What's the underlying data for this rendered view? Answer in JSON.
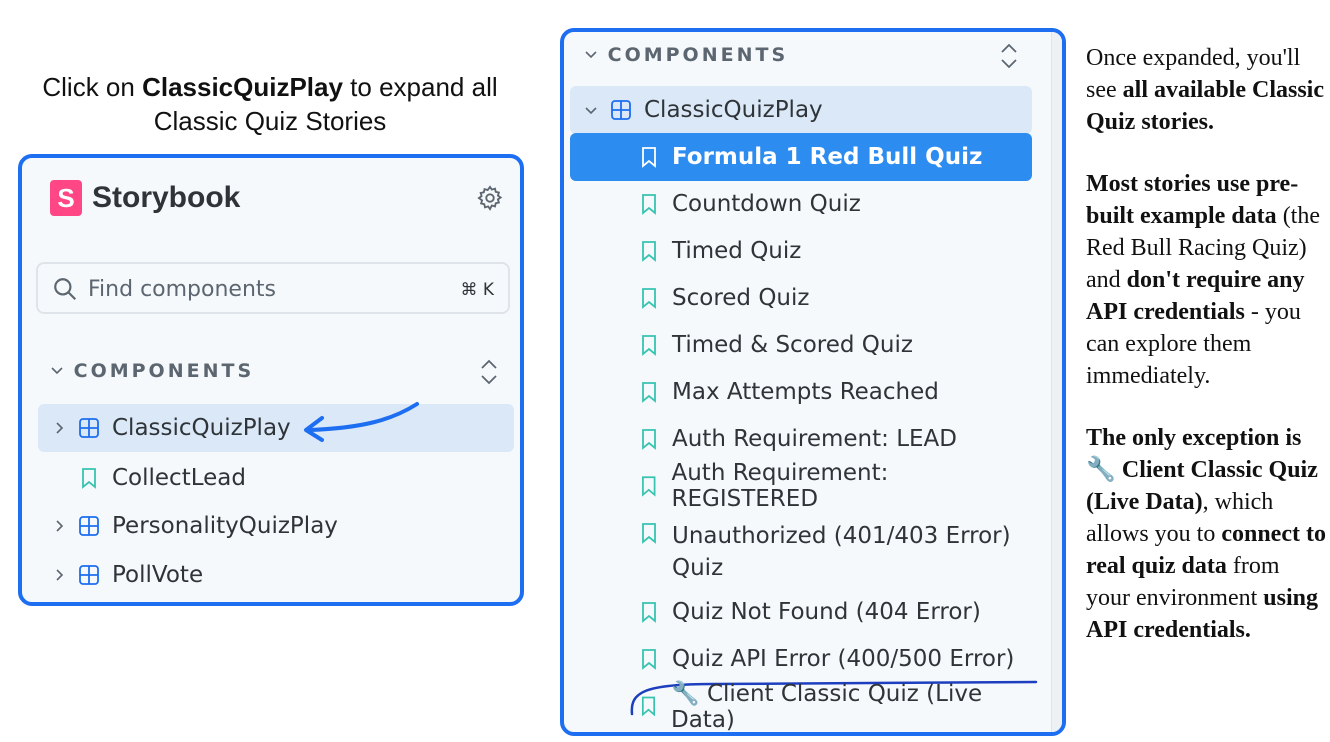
{
  "caption": {
    "before": "Click on ",
    "bold": "ClassicQuizPlay",
    "after": " to expand all Classic Quiz Stories"
  },
  "left_panel": {
    "brand": "Storybook",
    "logo_letter": "S",
    "search_placeholder": "Find components",
    "search_shortcut": "⌘ K",
    "section_label": "COMPONENTS",
    "items": [
      {
        "label": "ClassicQuizPlay",
        "kind": "component",
        "expanded": false,
        "highlighted": true
      },
      {
        "label": "CollectLead",
        "kind": "story"
      },
      {
        "label": "PersonalityQuizPlay",
        "kind": "component",
        "expanded": false
      },
      {
        "label": "PollVote",
        "kind": "component",
        "expanded": false
      }
    ]
  },
  "right_panel": {
    "section_label": "COMPONENTS",
    "group_label": "ClassicQuizPlay",
    "stories": [
      {
        "label": "Formula 1 Red Bull Quiz",
        "selected": true
      },
      {
        "label": "Countdown Quiz"
      },
      {
        "label": "Timed Quiz"
      },
      {
        "label": "Scored Quiz"
      },
      {
        "label": "Timed & Scored Quiz"
      },
      {
        "label": "Max Attempts Reached"
      },
      {
        "label": "Auth Requirement: LEAD"
      },
      {
        "label": "Auth Requirement: REGISTERED"
      },
      {
        "label": "Unauthorized (401/403 Error)",
        "label2": "Quiz"
      },
      {
        "label": "Quiz Not Found (404 Error)"
      },
      {
        "label": "Quiz API Error (400/500 Error)"
      },
      {
        "label": "🔧 Client Classic Quiz (Live Data)"
      }
    ]
  },
  "side_text": {
    "p1": {
      "t1": "Once expanded, you'll see ",
      "b1": "all available Classic Quiz stories."
    },
    "p2": {
      "b1": "Most stories use pre-built example data",
      "t1": " (the Red Bull Racing Quiz) and ",
      "b2": "don't require any API credentials",
      "t2": " - you can explore them immediately."
    },
    "p3": {
      "b1": "The only exception is 🔧 Client Classic Quiz (Live Data)",
      "t1": ", which allows you to ",
      "b2": "connect to real quiz data",
      "t2": " from your environment ",
      "b3": "using API credentials."
    }
  },
  "colors": {
    "frame_border": "#1d6ef0",
    "selected_row": "#2d8cf0",
    "highlight_row": "#dbe8f7",
    "component_icon": "#1d6ef0",
    "story_icon": "#37c3b0",
    "brand_pink": "#ff4785"
  }
}
